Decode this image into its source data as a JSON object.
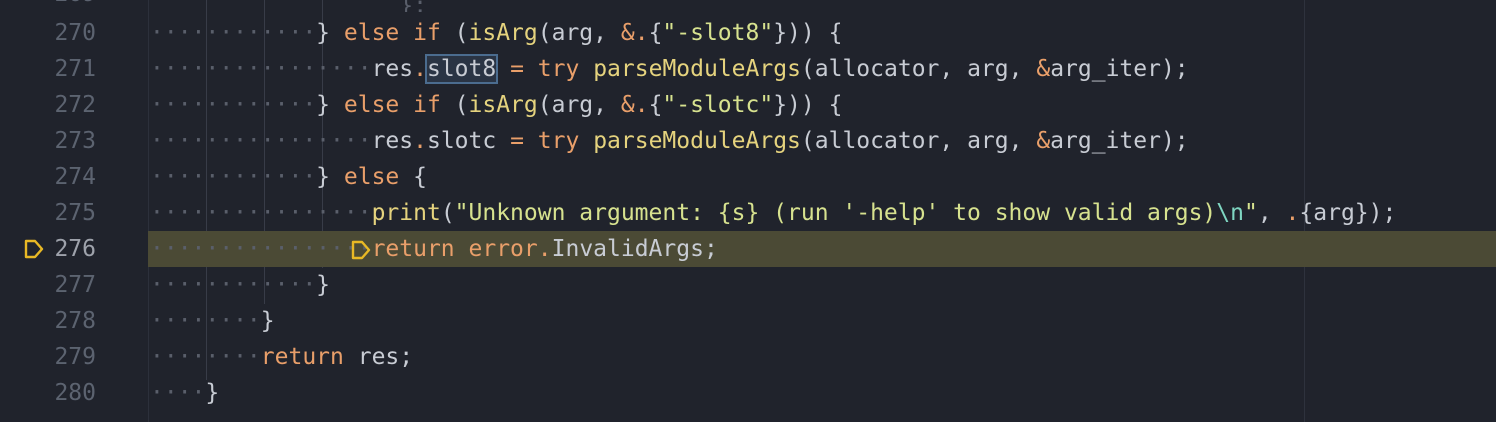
{
  "editor": {
    "language": "zig",
    "current_line": 276,
    "top_partial_line": "                  };",
    "lines": [
      {
        "n": "270",
        "indent": "············",
        "code": [
          [
            "punc",
            "} "
          ],
          [
            "kw",
            "else if"
          ],
          [
            "punc",
            " ("
          ],
          [
            "fn",
            "isArg"
          ],
          [
            "punc",
            "(arg, "
          ],
          [
            "op",
            "&."
          ],
          [
            "punc",
            "{"
          ],
          [
            "str",
            "\"-slot8\""
          ],
          [
            "punc",
            "})) {"
          ]
        ]
      },
      {
        "n": "271",
        "indent": "················",
        "code": [
          [
            "punc",
            "res"
          ],
          [
            "op",
            "."
          ],
          [
            "sel",
            "slot8"
          ],
          [
            "punc",
            " "
          ],
          [
            "op",
            "="
          ],
          [
            "punc",
            " "
          ],
          [
            "kw",
            "try"
          ],
          [
            "punc",
            " "
          ],
          [
            "fn",
            "parseModuleArgs"
          ],
          [
            "punc",
            "(allocator, arg, "
          ],
          [
            "op",
            "&"
          ],
          [
            "punc",
            "arg_iter);"
          ]
        ]
      },
      {
        "n": "272",
        "indent": "············",
        "code": [
          [
            "punc",
            "} "
          ],
          [
            "kw",
            "else if"
          ],
          [
            "punc",
            " ("
          ],
          [
            "fn",
            "isArg"
          ],
          [
            "punc",
            "(arg, "
          ],
          [
            "op",
            "&."
          ],
          [
            "punc",
            "{"
          ],
          [
            "str",
            "\"-slotc\""
          ],
          [
            "punc",
            "})) {"
          ]
        ]
      },
      {
        "n": "273",
        "indent": "················",
        "code": [
          [
            "punc",
            "res"
          ],
          [
            "op",
            "."
          ],
          [
            "punc",
            "slotc "
          ],
          [
            "op",
            "="
          ],
          [
            "punc",
            " "
          ],
          [
            "kw",
            "try"
          ],
          [
            "punc",
            " "
          ],
          [
            "fn",
            "parseModuleArgs"
          ],
          [
            "punc",
            "(allocator, arg, "
          ],
          [
            "op",
            "&"
          ],
          [
            "punc",
            "arg_iter);"
          ]
        ]
      },
      {
        "n": "274",
        "indent": "············",
        "code": [
          [
            "punc",
            "} "
          ],
          [
            "kw",
            "else"
          ],
          [
            "punc",
            " {"
          ]
        ]
      },
      {
        "n": "275",
        "indent": "················",
        "code": [
          [
            "fn",
            "print"
          ],
          [
            "punc",
            "("
          ],
          [
            "str",
            "\"Unknown argument: {s} (run '-help' to show valid args)"
          ],
          [
            "esc",
            "\\n"
          ],
          [
            "str",
            "\""
          ],
          [
            "punc",
            ", "
          ],
          [
            "op",
            "."
          ],
          [
            "punc",
            "{arg});"
          ]
        ]
      },
      {
        "n": "276",
        "indent": "················",
        "code": [
          [
            "kw",
            "return"
          ],
          [
            "punc",
            " "
          ],
          [
            "kw",
            "error"
          ],
          [
            "op",
            "."
          ],
          [
            "punc",
            "InvalidArgs;"
          ]
        ]
      },
      {
        "n": "277",
        "indent": "············",
        "code": [
          [
            "punc",
            "}"
          ]
        ]
      },
      {
        "n": "278",
        "indent": "········",
        "code": [
          [
            "punc",
            "}"
          ]
        ]
      },
      {
        "n": "279",
        "indent": "········",
        "code": [
          [
            "kw",
            "return"
          ],
          [
            "punc",
            " res;"
          ]
        ]
      },
      {
        "n": "280",
        "indent": "····",
        "code": [
          [
            "punc",
            "}"
          ]
        ]
      }
    ]
  },
  "colors": {
    "background": "#20232c",
    "current_line_highlight": "#4b4a35",
    "breakpoint": "#e8b825"
  },
  "icons": {
    "gutter_breakpoint": "breakpoint-icon",
    "inline_breakpoint": "inline-breakpoint-icon"
  }
}
